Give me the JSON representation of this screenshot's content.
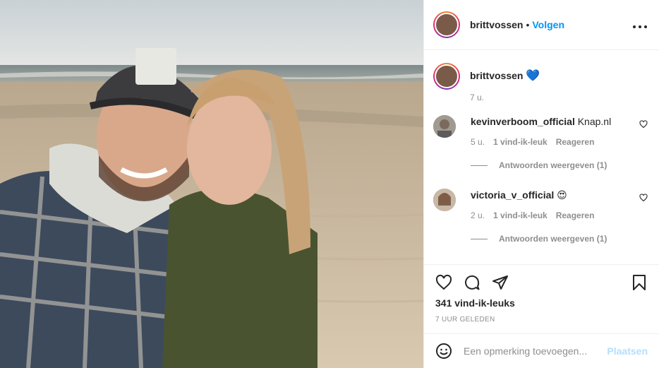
{
  "post": {
    "author": "brittvossen",
    "follow_separator": "•",
    "follow_label": "Volgen",
    "more_label": "•••",
    "caption": {
      "username": "brittvossen",
      "emoji": "💙",
      "age": "7 u."
    },
    "comments": [
      {
        "username": "kevinverboom_official",
        "text": "Knap.nl",
        "age": "5 u.",
        "likes": "1 vind-ik-leuk",
        "reply": "Reageren",
        "view_replies": "Antwoorden weergeven (1)"
      },
      {
        "username": "victoria_v_official",
        "text": "😍",
        "age": "2 u.",
        "likes": "1 vind-ik-leuk",
        "reply": "Reageren",
        "view_replies": "Antwoorden weergeven (1)"
      }
    ],
    "like_count": "341 vind-ik-leuks",
    "timestamp": "7 UUR GELEDEN",
    "add_comment_placeholder": "Een opmerking toevoegen...",
    "post_button": "Plaatsen"
  },
  "icons": {
    "like": "heart-outline-icon",
    "comment": "comment-bubble-icon",
    "share": "paper-plane-icon",
    "save": "bookmark-icon",
    "emoji": "smiley-icon",
    "more": "more-options-icon",
    "verified_heart": "blue-heart-emoji"
  },
  "colors": {
    "accent": "#0095f6",
    "muted": "#8e8e8e",
    "text": "#262626",
    "post_disabled": "#b2dffc",
    "border": "#efefef"
  }
}
